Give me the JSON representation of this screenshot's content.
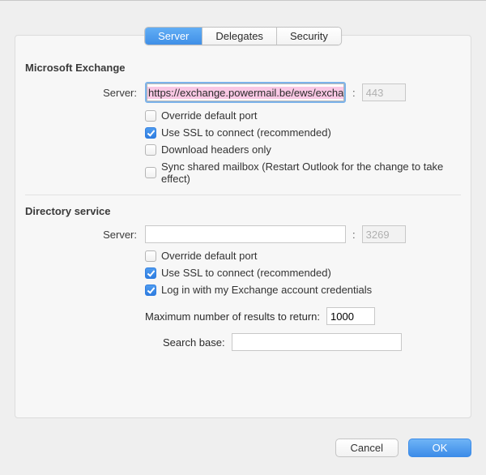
{
  "tabs": {
    "server": "Server",
    "delegates": "Delegates",
    "security": "Security",
    "active": "server"
  },
  "exchange": {
    "section_title": "Microsoft Exchange",
    "server_label": "Server:",
    "server_value": "https://exchange.powermail.be/ews/exchang",
    "port_sep": ":",
    "port_value": "443",
    "override_port": {
      "checked": false,
      "label": "Override default port"
    },
    "use_ssl": {
      "checked": true,
      "label": "Use SSL to connect (recommended)"
    },
    "headers_only": {
      "checked": false,
      "label": "Download headers only"
    },
    "sync_shared": {
      "checked": false,
      "label": "Sync shared mailbox (Restart Outlook for the change to take effect)"
    }
  },
  "directory": {
    "section_title": "Directory service",
    "server_label": "Server:",
    "server_value": "",
    "port_sep": ":",
    "port_value": "3269",
    "override_port": {
      "checked": false,
      "label": "Override default port"
    },
    "use_ssl": {
      "checked": true,
      "label": "Use SSL to connect (recommended)"
    },
    "login_exchange": {
      "checked": true,
      "label": "Log in with my Exchange account credentials"
    },
    "max_results_label": "Maximum number of results to return:",
    "max_results_value": "1000",
    "search_base_label": "Search base:",
    "search_base_value": ""
  },
  "footer": {
    "cancel": "Cancel",
    "ok": "OK"
  }
}
